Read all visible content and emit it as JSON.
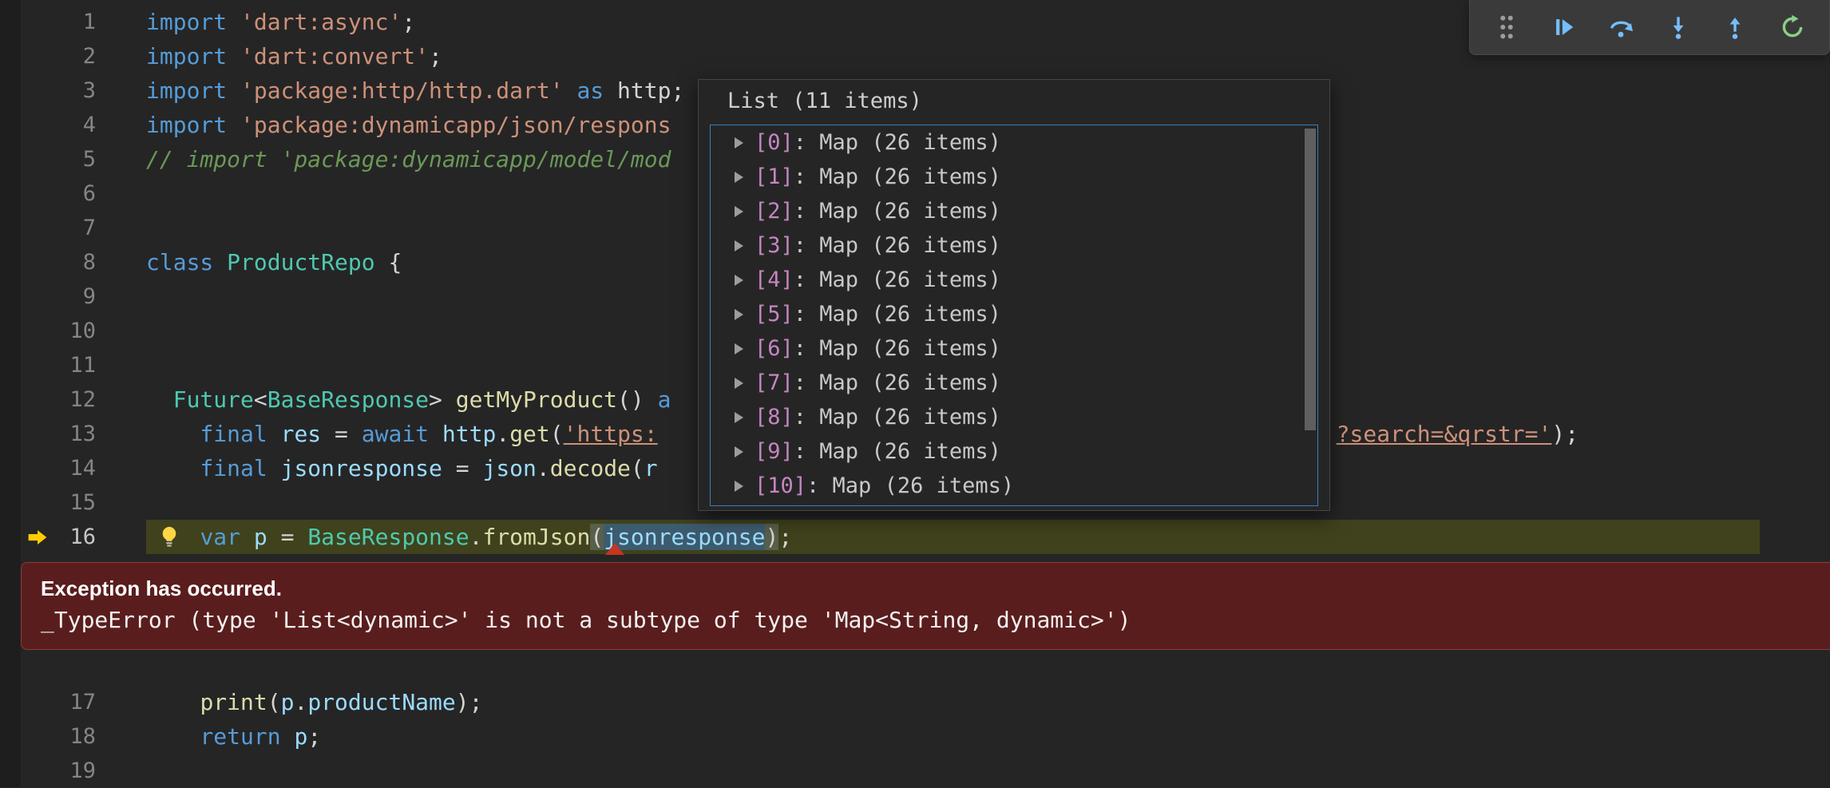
{
  "colors": {
    "bg": "#252526",
    "edge": "#1e1e1e",
    "lnum": "#858585",
    "hl": "#3f421c",
    "kw": "#569cd6",
    "ty": "#4ec9b0",
    "fn": "#dcdcaa",
    "str": "#ce9178",
    "cm": "#6a9955",
    "vr": "#9cdcfe",
    "pl": "#d4d4d4",
    "sel": "#3d5b6e",
    "exbg": "#5a1d1d",
    "exbd": "#8f3a3a",
    "ptr": "#c5351f",
    "blue": "#75beff",
    "green": "#89d185",
    "grip": "#9d9d9d",
    "yellow": "#ffcc00",
    "tbbg": "#3a3a3a",
    "popbg": "#252526",
    "popbd": "#454545",
    "listbd": "#3c7eb5",
    "idx": "#c586c0",
    "val": "#c8c8c8",
    "sb": "#5f5f5f",
    "bulb": "#ffd644"
  },
  "toolbar": {
    "icons": [
      "drag-handle",
      "continue",
      "step-over",
      "step-into",
      "step-out",
      "restart"
    ]
  },
  "debug_popup": {
    "title": "List (11 items)",
    "separator": ": ",
    "items": [
      {
        "index": "[0]",
        "value": "Map (26 items)"
      },
      {
        "index": "[1]",
        "value": "Map (26 items)"
      },
      {
        "index": "[2]",
        "value": "Map (26 items)"
      },
      {
        "index": "[3]",
        "value": "Map (26 items)"
      },
      {
        "index": "[4]",
        "value": "Map (26 items)"
      },
      {
        "index": "[5]",
        "value": "Map (26 items)"
      },
      {
        "index": "[6]",
        "value": "Map (26 items)"
      },
      {
        "index": "[7]",
        "value": "Map (26 items)"
      },
      {
        "index": "[8]",
        "value": "Map (26 items)"
      },
      {
        "index": "[9]",
        "value": "Map (26 items)"
      },
      {
        "index": "[10]",
        "value": "Map (26 items)"
      }
    ]
  },
  "exception_widget": {
    "title": "Exception has occurred.",
    "message": "_TypeError (type 'List<dynamic>' is not a subtype of type 'Map<String, dynamic>')"
  },
  "editor": {
    "lines_a": [
      {
        "n": 1,
        "tokens": [
          [
            "kw",
            "import"
          ],
          [
            "pl",
            " "
          ],
          [
            "str",
            "'dart:async'"
          ],
          [
            "pl",
            ";"
          ]
        ]
      },
      {
        "n": 2,
        "tokens": [
          [
            "kw",
            "import"
          ],
          [
            "pl",
            " "
          ],
          [
            "str",
            "'dart:convert'"
          ],
          [
            "pl",
            ";"
          ]
        ]
      },
      {
        "n": 3,
        "tokens": [
          [
            "kw",
            "import"
          ],
          [
            "pl",
            " "
          ],
          [
            "str",
            "'package:http/http.dart'"
          ],
          [
            "pl",
            " "
          ],
          [
            "kw",
            "as"
          ],
          [
            "pl",
            " http;"
          ]
        ]
      },
      {
        "n": 4,
        "tokens": [
          [
            "kw",
            "import"
          ],
          [
            "pl",
            " "
          ],
          [
            "str",
            "'package:dynamicapp/json/respons"
          ]
        ]
      },
      {
        "n": 5,
        "tokens": [
          [
            "cm",
            "// import 'package:dynamicapp/model/mod"
          ]
        ]
      },
      {
        "n": 6,
        "tokens": []
      },
      {
        "n": 7,
        "tokens": []
      },
      {
        "n": 8,
        "tokens": [
          [
            "kw",
            "class"
          ],
          [
            "pl",
            " "
          ],
          [
            "ty",
            "ProductRepo"
          ],
          [
            "pl",
            " {"
          ]
        ]
      },
      {
        "n": 9,
        "tokens": []
      },
      {
        "n": 10,
        "tokens": []
      },
      {
        "n": 11,
        "tokens": []
      },
      {
        "n": 12,
        "tokens": [
          [
            "pl",
            "  "
          ],
          [
            "ty",
            "Future"
          ],
          [
            "pl",
            "<"
          ],
          [
            "ty",
            "BaseResponse"
          ],
          [
            "pl",
            "> "
          ],
          [
            "fn",
            "getMyProduct"
          ],
          [
            "pl",
            "() "
          ],
          [
            "kw",
            "a"
          ]
        ]
      },
      {
        "n": 13,
        "tokens": [
          [
            "pl",
            "    "
          ],
          [
            "kw",
            "final"
          ],
          [
            "pl",
            " "
          ],
          [
            "vr",
            "res"
          ],
          [
            "pl",
            " = "
          ],
          [
            "kw",
            "await"
          ],
          [
            "pl",
            " "
          ],
          [
            "vr",
            "http"
          ],
          [
            "pl",
            "."
          ],
          [
            "fn",
            "get"
          ],
          [
            "pl",
            "("
          ],
          [
            "lnk",
            "'https:"
          ],
          [
            "gap",
            850
          ],
          [
            "lnk",
            "?search=&qrstr='"
          ],
          [
            "pl",
            ");"
          ]
        ]
      },
      {
        "n": 14,
        "tokens": [
          [
            "pl",
            "    "
          ],
          [
            "kw",
            "final"
          ],
          [
            "pl",
            " "
          ],
          [
            "vr",
            "jsonresponse"
          ],
          [
            "pl",
            " = "
          ],
          [
            "vr",
            "json"
          ],
          [
            "pl",
            "."
          ],
          [
            "fn",
            "decode"
          ],
          [
            "pl",
            "("
          ],
          [
            "vr",
            "r"
          ]
        ]
      },
      {
        "n": 15,
        "tokens": []
      },
      {
        "n": 16,
        "current": true,
        "tokens": [
          [
            "pl",
            "    "
          ],
          [
            "kw",
            "var"
          ],
          [
            "pl",
            " "
          ],
          [
            "vr",
            "p"
          ],
          [
            "pl",
            " = "
          ],
          [
            "ty",
            "BaseResponse"
          ],
          [
            "pl",
            "."
          ],
          [
            "fn",
            "fromJson"
          ],
          [
            "br",
            "("
          ],
          [
            "sel",
            "jsonresponse"
          ],
          [
            "br",
            ")"
          ],
          [
            "pl",
            ";"
          ]
        ]
      }
    ],
    "lines_b": [
      {
        "n": 17,
        "tokens": [
          [
            "pl",
            "    "
          ],
          [
            "fn",
            "print"
          ],
          [
            "pl",
            "("
          ],
          [
            "vr",
            "p"
          ],
          [
            "pl",
            "."
          ],
          [
            "vr",
            "productName"
          ],
          [
            "pl",
            ");"
          ]
        ]
      },
      {
        "n": 18,
        "tokens": [
          [
            "pl",
            "    "
          ],
          [
            "kw",
            "return"
          ],
          [
            "pl",
            " "
          ],
          [
            "vr",
            "p"
          ],
          [
            "pl",
            ";"
          ]
        ]
      },
      {
        "n": 19,
        "tokens": []
      }
    ]
  }
}
